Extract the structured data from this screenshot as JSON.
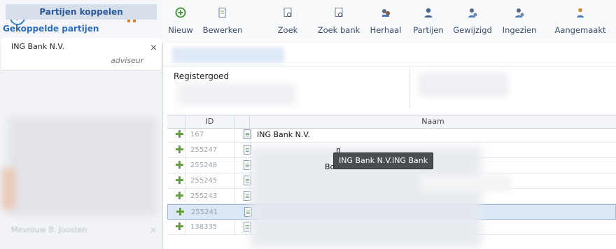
{
  "nav": {
    "back_icon": "arrow-left-circle-icon",
    "home_icon": "home-icon"
  },
  "toolbar": {
    "items": [
      {
        "label": "Nieuw",
        "icon": "add-circle-icon"
      },
      {
        "label": "Bewerken",
        "icon": "edit-document-icon"
      },
      {
        "label": "Zoek",
        "icon": "search-document-icon"
      },
      {
        "label": "Zoek bank",
        "icon": "search-bank-icon"
      },
      {
        "label": "Herhaal",
        "icon": "repeat-users-icon"
      },
      {
        "label": "Partijen",
        "icon": "parties-icon"
      },
      {
        "label": "Gewijzigd",
        "icon": "changed-users-icon"
      },
      {
        "label": "Ingezien",
        "icon": "viewed-users-icon"
      },
      {
        "label": "Aangemaakt",
        "icon": "created-users-icon"
      }
    ]
  },
  "left_panel": {
    "header": "Partijen koppelen",
    "subheader": "Gekoppelde partijen",
    "card": {
      "name": "ING Bank N.V.",
      "role": "adviseur",
      "close": "×"
    },
    "faded_item": {
      "name": "Mevrouw B. Joosten",
      "close": "×"
    }
  },
  "main": {
    "section_label": "Registergoed",
    "grid": {
      "columns": [
        "ID",
        "Naam"
      ],
      "rows": [
        {
          "id": "167",
          "name": "ING Bank N.V.",
          "selected": false
        },
        {
          "id": "255247",
          "name": "",
          "selected": false
        },
        {
          "id": "255248",
          "name": "",
          "selected": false
        },
        {
          "id": "255245",
          "name": "",
          "selected": false
        },
        {
          "id": "255243",
          "name": "",
          "selected": false
        },
        {
          "id": "255241",
          "name": "",
          "selected": true
        },
        {
          "id": "138335",
          "name": "",
          "selected": false
        }
      ]
    },
    "tooltip": "ING Bank N.V.ING Bank",
    "peek_a": "n",
    "peek_b": "Bo"
  },
  "colors": {
    "accent": "#2e6cbe",
    "add_green": "#5f9e3a",
    "tooltip_bg": "#4a4d52",
    "selected_row": "#dbe7f7"
  }
}
